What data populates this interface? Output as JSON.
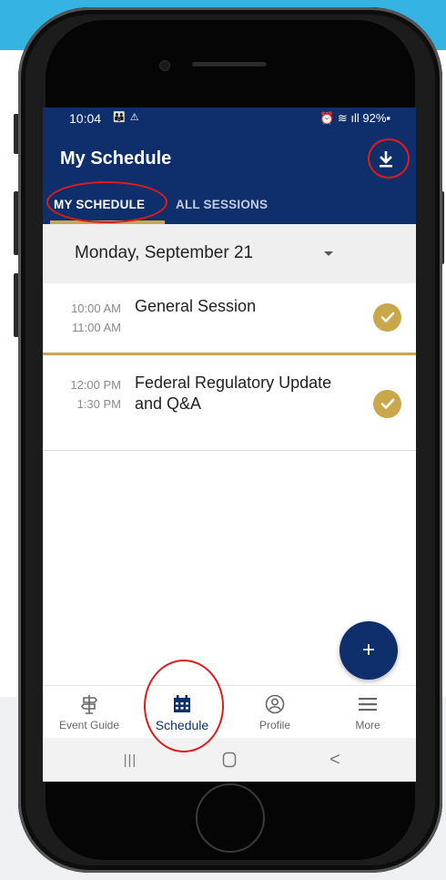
{
  "status_bar": {
    "time": "10:04",
    "left_icons": "👪 ⚠",
    "right_icons": "⏰ ≋ ıll 92%▪"
  },
  "app_bar": {
    "title": "My Schedule",
    "download_icon": "download-icon"
  },
  "tabs": [
    {
      "label": "MY SCHEDULE",
      "active": true
    },
    {
      "label": "ALL SESSIONS",
      "active": false
    }
  ],
  "date_selector": {
    "value": "Monday, September 21"
  },
  "sessions": [
    {
      "start": "10:00 AM",
      "end": "11:00 AM",
      "title": "General Session",
      "added": true
    },
    {
      "start": "12:00 PM",
      "end": "1:30 PM",
      "title": "Federal Regulatory Update and Q&A",
      "added": true
    }
  ],
  "fab": {
    "label": "+"
  },
  "bottom_nav": [
    {
      "label": "Event Guide",
      "icon": "signpost-icon",
      "active": false
    },
    {
      "label": "Schedule",
      "icon": "calendar-icon",
      "active": true
    },
    {
      "label": "Profile",
      "icon": "profile-icon",
      "active": false
    },
    {
      "label": "More",
      "icon": "menu-icon",
      "active": false
    }
  ],
  "android_nav": {
    "recents": "|||",
    "home": "○",
    "back": "<"
  },
  "colors": {
    "primary": "#0e2f6b",
    "accent": "#c9a84c",
    "highlight_annotation": "#e01b1b",
    "background_top": "#35b3e3"
  }
}
